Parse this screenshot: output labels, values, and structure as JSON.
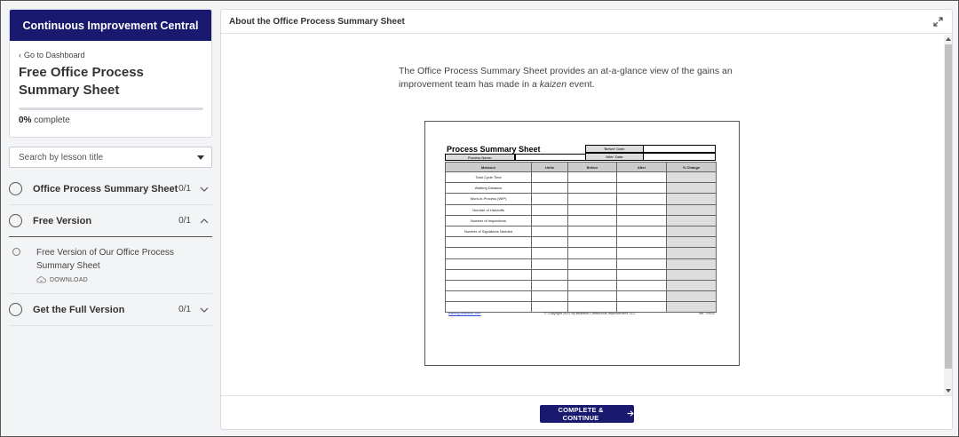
{
  "sidebar": {
    "brand": "Continuous Improvement Central",
    "back_link": "Go to Dashboard",
    "course_title": "Free Office Process Summary Sheet",
    "progress": {
      "percent_value": 0,
      "percent": "0%",
      "suffix": "complete"
    },
    "search_placeholder": "Search by lesson title",
    "sections": [
      {
        "title": "Office Process Summary Sheet",
        "count": "0/1",
        "expanded": false
      },
      {
        "title": "Free Version",
        "count": "0/1",
        "expanded": true,
        "lessons": [
          {
            "title": "Free Version of Our Office Process Summary Sheet",
            "action": "DOWNLOAD"
          }
        ]
      },
      {
        "title": "Get the Full Version",
        "count": "0/1",
        "expanded": false
      }
    ]
  },
  "main": {
    "title": "About the Office Process Summary Sheet",
    "intro_before": "The Office Process Summary Sheet provides an at-a-glance view of the gains an improvement team has made in a ",
    "intro_emphasis": "kaizen",
    "intro_after": " event.",
    "complete_button": "COMPLETE & CONTINUE"
  },
  "document": {
    "title": "Process Summary Sheet",
    "process_name_label": "Process Name:",
    "before_date_label": "'Before' Date:",
    "after_date_label": "'After' Date:",
    "columns": [
      "Measure",
      "Units",
      "Before",
      "After",
      "% Change"
    ],
    "measures": [
      "Total Cycle Time",
      "Walking Distance",
      "Work-in-Process (WIP)",
      "Number of Handoffs",
      "Number of Inspections",
      "Number of Signatures Needed",
      "",
      "",
      "",
      "",
      "",
      "",
      ""
    ],
    "footer": {
      "link": "training.leliaction.com",
      "copyright": "© Copyright 2021 by leliaction Continuous Improvement, LLC",
      "version": "ver. 7/9/21"
    }
  },
  "colors": {
    "brand_navy": "#191970",
    "background": "#f3f4f6"
  }
}
